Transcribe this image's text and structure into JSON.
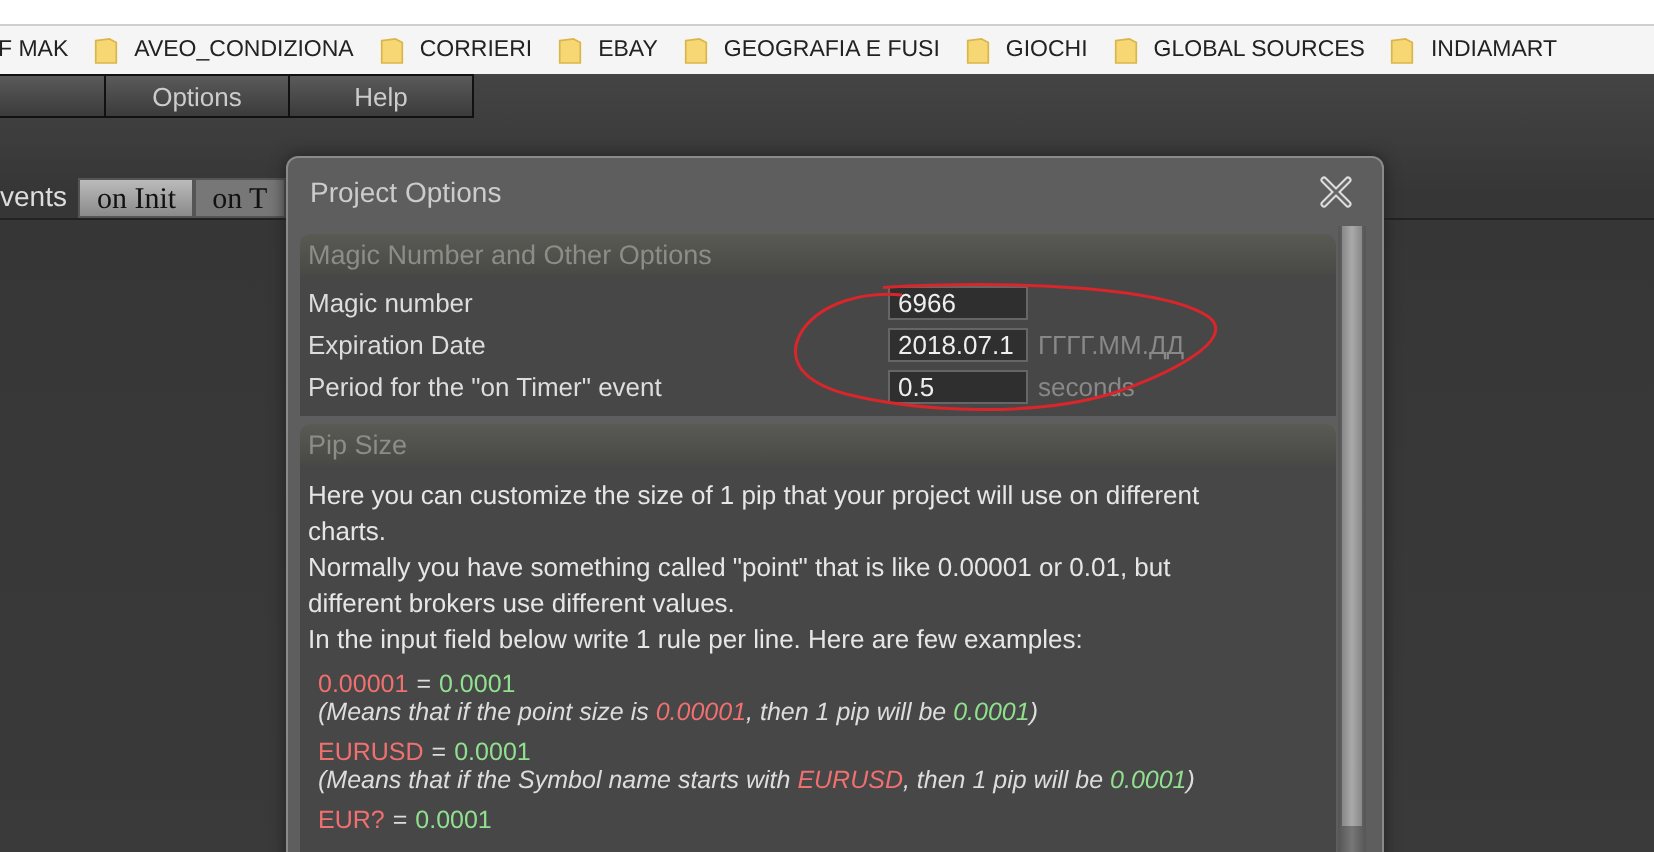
{
  "bookmarks": [
    {
      "label": "F MAK",
      "kind": "plain"
    },
    {
      "label": "AVEO_CONDIZIONA",
      "kind": "folder"
    },
    {
      "label": "CORRIERI",
      "kind": "folder"
    },
    {
      "label": "EBAY",
      "kind": "folder"
    },
    {
      "label": "GEOGRAFIA E FUSI",
      "kind": "folder"
    },
    {
      "label": "GIOCHI",
      "kind": "folder"
    },
    {
      "label": "GLOBAL SOURCES",
      "kind": "folder"
    },
    {
      "label": "INDIAMART",
      "kind": "folder"
    }
  ],
  "menu": [
    "Options",
    "Help"
  ],
  "events_label": "vents",
  "tabs": [
    {
      "label": "on Init",
      "selected": true
    },
    {
      "label": "on T",
      "selected": false
    }
  ],
  "dialog": {
    "title": "Project Options",
    "sections": [
      {
        "kind": "fields",
        "title": "Magic Number and Other Options",
        "fields": [
          {
            "label": "Magic number",
            "value": "6966"
          },
          {
            "label": "Expiration Date",
            "value": "2018.07.1",
            "hint": "ГГГГ.ММ.ДД"
          },
          {
            "label": "Period for the \"on Timer\" event",
            "value": "0.5",
            "hint": "seconds"
          }
        ]
      },
      {
        "kind": "text",
        "title": "Pip Size",
        "paragraphs": [
          "Here you can customize the size of 1 pip that your project will use on different charts.",
          "Normally you have something called \"point\" that is like 0.00001 or 0.01, but different brokers use different values.",
          "In the input field below write 1 rule per line. Here are few examples:"
        ],
        "examples": [
          {
            "key": "0.00001",
            "separator": "=",
            "value": "0.0001",
            "note": [
              {
                "text": "(Means that if the point size is "
              },
              {
                "text": "0.00001",
                "color": "#f07070"
              },
              {
                "text": ", then 1 pip will be "
              },
              {
                "text": "0.0001",
                "color": "#90e090"
              },
              {
                "text": ")"
              }
            ]
          },
          {
            "key": "EURUSD",
            "separator": "=",
            "value": "0.0001",
            "note": [
              {
                "text": "(Means that if the Symbol name starts with "
              },
              {
                "text": "EURUSD",
                "color": "#f07070"
              },
              {
                "text": ", then 1 pip will be "
              },
              {
                "text": "0.0001",
                "color": "#90e090"
              },
              {
                "text": ")"
              }
            ]
          },
          {
            "key": "EUR?",
            "separator": "=",
            "value": "0.0001"
          }
        ]
      }
    ]
  },
  "annotations": [
    {
      "kind": "ellipse",
      "color": "#d8262b"
    }
  ]
}
